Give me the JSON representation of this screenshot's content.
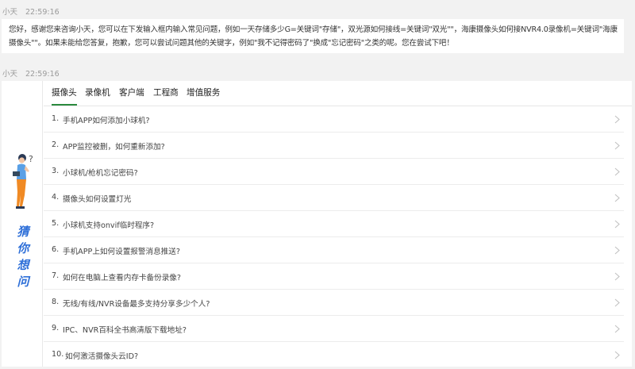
{
  "messages": [
    {
      "sender": "小天",
      "time": "22:59:16",
      "text": "您好，感谢您来咨询小天，您可以在下发输入框内输入常见问题，例如一天存储多少G=关键词\"存储\"，双光源如何接线=关键词\"双光\"\"，海康摄像头如何接NVR4.0录像机=关键词\"海康摄像头\"\"。如果未能给您答复，抱歉，您可以尝试问题其他的关键字，例如\"我不记得密码了\"换成\"忘记密码\"之类的呢。您在尝试下吧！"
    },
    {
      "sender": "小天",
      "time": "22:59:16"
    }
  ],
  "faq_card": {
    "side_label": [
      "猜",
      "你",
      "想",
      "问"
    ],
    "tabs": [
      {
        "label": "摄像头",
        "active": true
      },
      {
        "label": "录像机",
        "active": false
      },
      {
        "label": "客户端",
        "active": false
      },
      {
        "label": "工程商",
        "active": false
      },
      {
        "label": "增值服务",
        "active": false
      }
    ],
    "accent_color": "#2b8a3e",
    "items": [
      {
        "num": "1.",
        "text": "手机APP如何添加小球机?"
      },
      {
        "num": "2.",
        "text": "APP监控被删，如何重新添加?"
      },
      {
        "num": "3.",
        "text": "小球机/枪机忘记密码?"
      },
      {
        "num": "4.",
        "text": "摄像头如何设置灯光"
      },
      {
        "num": "5.",
        "text": "小球机支持onvif临时程序?"
      },
      {
        "num": "6.",
        "text": "手机APP上如何设置报警消息推送?"
      },
      {
        "num": "7.",
        "text": "如何在电脑上查看内存卡备份录像?"
      },
      {
        "num": "8.",
        "text": "无线/有线/NVR设备最多支持分享多少个人?"
      },
      {
        "num": "9.",
        "text": "IPC、NVR百科全书高清版下载地址?"
      },
      {
        "num": "10.",
        "text": "如何激活摄像头云ID?"
      }
    ]
  }
}
